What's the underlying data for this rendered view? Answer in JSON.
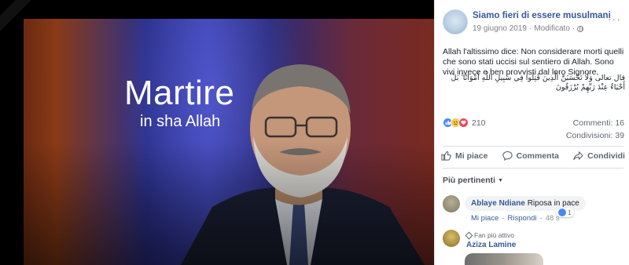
{
  "photo": {
    "title": "Martire",
    "subtitle": "in sha Allah"
  },
  "post": {
    "page_name": "Siamo fieri di essere musulmani",
    "date": "19 giugno 2019",
    "separator": "·",
    "edited": "Modificato",
    "text": "Allah l'altissimo dice: Non considerare morti quelli che sono stati uccisi sul sentiero di Allah. Sono vivi invece e ben provvisti dal loro Signore,",
    "arabic": "قال تعالى وَلَا تَحْسَبَنَّ الَّذِينَ قُتِلُوا فِي سَبِيلِ اللَّهِ أَمْوَاتًا ۚ بَلْ أَحْيَاءٌ عِنْدَ رَبِّهِمْ يُرْزَقُونَ",
    "more_icon": "ellipsis-icon"
  },
  "stats": {
    "reactions_count": "210",
    "comments": "Commenti: 16",
    "shares": "Condivisioni: 39"
  },
  "actions": {
    "like": "Mi piace",
    "comment": "Commenta",
    "share": "Condividi"
  },
  "comments": {
    "sort_label": "Più pertinenti",
    "items": [
      {
        "author": "Ablaye Ndiane",
        "text": "Riposa in pace",
        "like_action": "Mi piace",
        "reply_action": "Rispondi",
        "time": "48 s",
        "likes": "1"
      },
      {
        "badge": "Fan più attivo",
        "author": "Aziza Lamine"
      }
    ]
  },
  "colors": {
    "link": "#385898",
    "like_blue": "#4a89f3",
    "love_red": "#f0435b",
    "sad_yellow": "#f2c94c"
  }
}
